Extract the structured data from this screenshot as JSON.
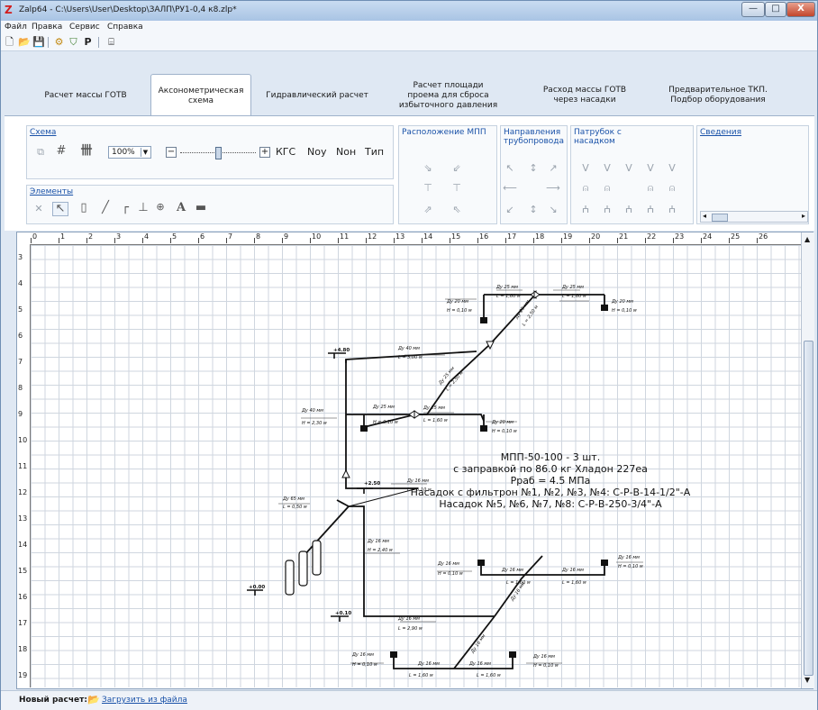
{
  "window": {
    "title": "Zalp64 - C:\\Users\\User\\Desktop\\ЗАЛП\\РУ1-0,4 к8.zlp*",
    "minimize_label": "—",
    "maximize_label": "□",
    "close_label": "X"
  },
  "menu": [
    "Файл",
    "Правка",
    "Сервис",
    "Справка"
  ],
  "toolbar": {
    "icons": [
      "new-file-icon",
      "open-folder-icon",
      "save-icon",
      "calc-icon",
      "shield-icon",
      "text-p-icon",
      "layout-icon"
    ],
    "glyphs": [
      "🗋",
      "📂",
      "💾",
      "⚙",
      "⛉",
      "Р",
      "⌸"
    ]
  },
  "tabs": [
    {
      "label": "Расчет массы ГОТВ",
      "active": false
    },
    {
      "label": "Аксонометрическая схема",
      "active": true
    },
    {
      "label": "Гидравлический расчет",
      "active": false
    },
    {
      "label": "Расчет площади проема для сброса избыточного давления",
      "active": false
    },
    {
      "label": "Расход массы ГОТВ через насадки",
      "active": false
    },
    {
      "label": "Предварительное ТКП. Подбор оборудования",
      "active": false
    }
  ],
  "ribbon": {
    "schema": {
      "label": "Схема",
      "zoom": "100%",
      "buttons": [
        "КГС",
        "Nоу",
        "Nон",
        "Тип"
      ],
      "minus": "−",
      "plus": "+"
    },
    "elements": {
      "label": "Элементы",
      "text_tool": "A"
    },
    "mpp_location": {
      "label": "Расположение МПП"
    },
    "pipe_direction": {
      "label": "Направления трубопровода"
    },
    "nozzle_fitting": {
      "label": "Патрубок с насадком"
    },
    "info": {
      "label": "Сведения"
    }
  },
  "ruler": {
    "h": [
      "0",
      "1",
      "2",
      "3",
      "4",
      "5",
      "6",
      "7",
      "8",
      "9",
      "10",
      "11",
      "12",
      "13",
      "14",
      "15",
      "16",
      "17",
      "18",
      "19",
      "20",
      "21",
      "22",
      "23",
      "24",
      "25",
      "26"
    ],
    "v": [
      "3",
      "4",
      "5",
      "6",
      "7",
      "8",
      "9",
      "10",
      "11",
      "12",
      "13",
      "14",
      "15",
      "16",
      "17",
      "18",
      "19"
    ]
  },
  "drawing": {
    "annotation_lines": [
      "МПП-50-100 - 3 шт.",
      "с заправкой по 86.0 кг Хладон 227еа",
      "Pраб = 4.5 МПа",
      "Насадок с фильтрон №1, №2, №3, №4: С-Р-В-14-1/2\"-А",
      "Насадок №5, №6, №7, №8: С-Р-В-250-3/4\"-А"
    ],
    "level_marks": [
      "+4.80",
      "+2.50",
      "+0.00",
      "+0.10"
    ],
    "pipe_labels": {
      "dy25": "Ду 25 мм",
      "dy20": "Ду 20 мм",
      "dy40": "Ду 40 мм",
      "dy65": "Ду 65 мм",
      "dy16": "Ду 16 мм",
      "l160": "L = 1,60 м",
      "l250": "L = 2,50 м",
      "l300": "L = 3,00 м",
      "l050": "L = 0,50 м",
      "l010": "L = 0,10 м",
      "l290": "L = 2,90 м",
      "h010": "H = 0,10 м",
      "h230": "H = 2,30 м",
      "h240": "H = 2,40 м"
    }
  },
  "status": {
    "label": "Новый расчет:",
    "link": "Загрузить из файла"
  },
  "colors": {
    "title_bg": "#b7cde8",
    "link": "#1a52a8",
    "close": "#c2452b",
    "grid": "#cfd6df"
  }
}
